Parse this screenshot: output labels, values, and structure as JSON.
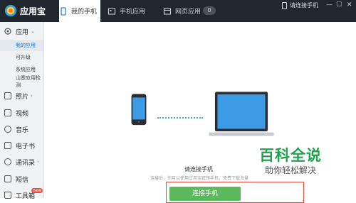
{
  "app": {
    "title": "应用宝"
  },
  "tabs": [
    {
      "label": "我的手机",
      "active": true
    },
    {
      "label": "手机应用",
      "active": false
    },
    {
      "label": "网页应用",
      "active": false
    }
  ],
  "tab_badge": "0",
  "top_right": {
    "connect_label": "请连接手机",
    "minimize": "—",
    "maximize": "☐",
    "close": "✕"
  },
  "sidebar": {
    "apps_label": "应用",
    "apps_sub": [
      {
        "label": "我的应用",
        "active": true
      },
      {
        "label": "可升级",
        "active": false
      },
      {
        "label": "系统应用",
        "active": false
      },
      {
        "label": "山寨应用检测",
        "active": false
      }
    ],
    "items": [
      {
        "label": "照片"
      },
      {
        "label": "视频"
      },
      {
        "label": "音乐"
      },
      {
        "label": "电子书"
      },
      {
        "label": "通讯录"
      },
      {
        "label": "短信"
      },
      {
        "label": "工具箱"
      }
    ],
    "new_badge": "new"
  },
  "main": {
    "connect_title": "请连接手机",
    "connect_desc": "连接后，你可以使用应用宝管理手机，免费下载海量",
    "connect_button": "连接手机"
  },
  "watermark": {
    "line1": "百科全说",
    "line2": "助你轻松解决"
  },
  "colors": {
    "topbar": "#21272e",
    "accent_blue": "#1a78d2",
    "button_green": "#5cb85c",
    "watermark_green": "#1fa34a",
    "highlight_red": "#e84c3d"
  }
}
